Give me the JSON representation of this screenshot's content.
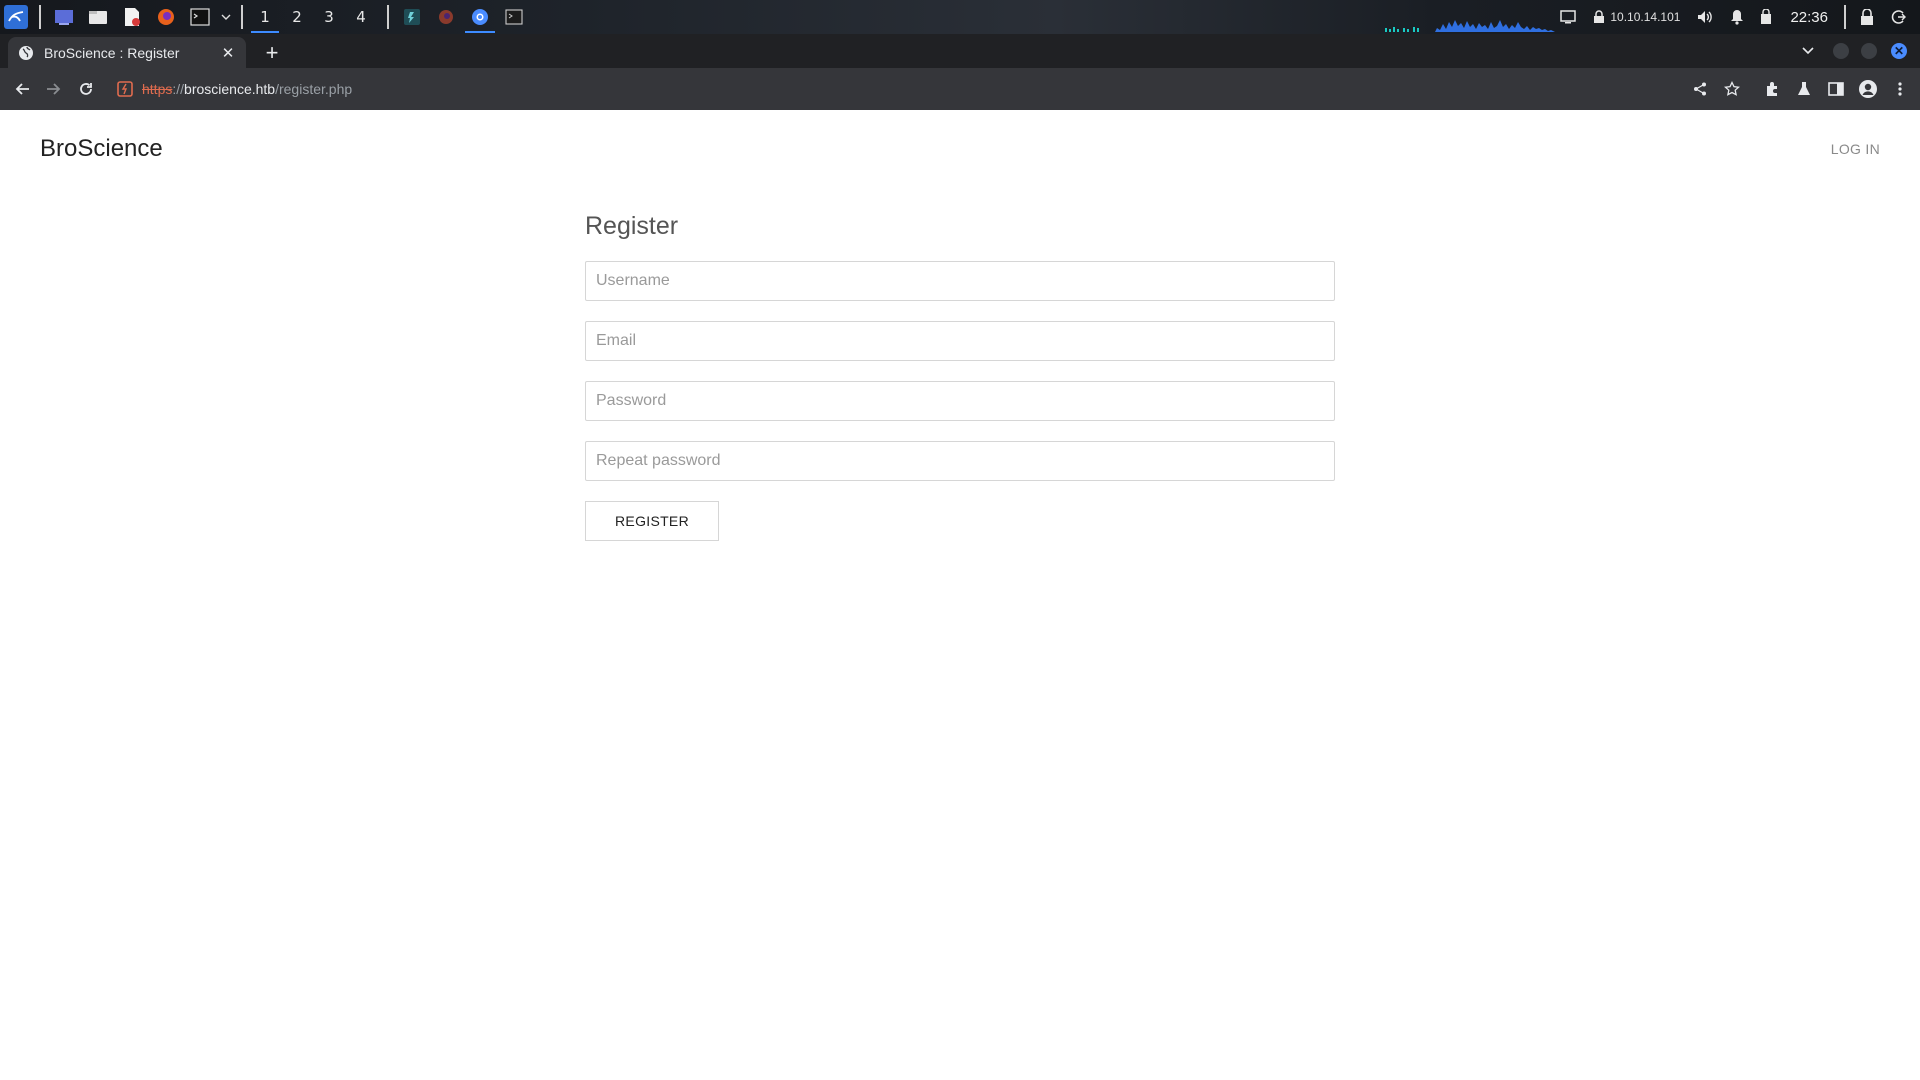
{
  "taskbar": {
    "workspaces": [
      "1",
      "2",
      "3",
      "4"
    ],
    "active_workspace": "1",
    "ip_address": "10.10.14.101",
    "clock": "22:36"
  },
  "browser": {
    "tab_title": "BroScience : Register",
    "url": {
      "scheme": "https",
      "separator": "://",
      "host": "broscience.htb",
      "path": "/register.php"
    }
  },
  "page": {
    "brand": "BroScience",
    "login_link": "LOG IN",
    "form": {
      "title": "Register",
      "username_placeholder": "Username",
      "email_placeholder": "Email",
      "password_placeholder": "Password",
      "repeat_password_placeholder": "Repeat password",
      "submit_label": "REGISTER"
    }
  },
  "colors": {
    "accent": "#3d8bff",
    "insecure_scheme": "#e06c4f",
    "toolbar": "#35363a",
    "tabstrip": "#202124"
  }
}
